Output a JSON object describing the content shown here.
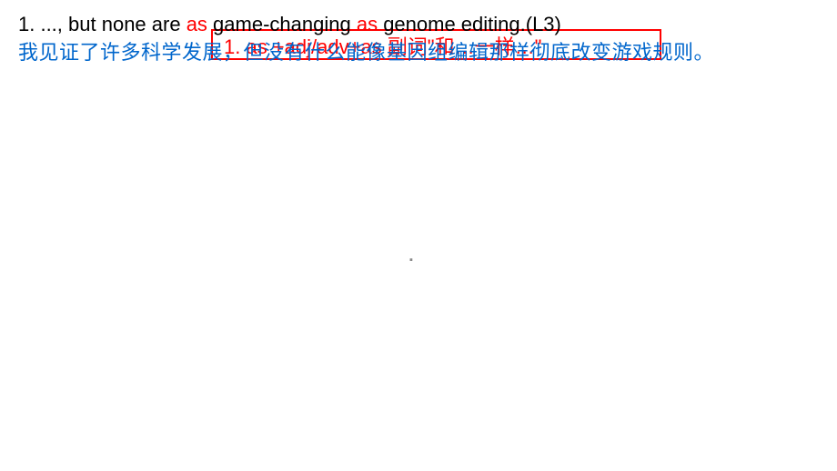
{
  "line1": {
    "prefix": "1. ..., but none are ",
    "as1": "as",
    "mid": " game-changing ",
    "as2": "as",
    "suffix": " genome editing.(L3)"
  },
  "red_box_content": "1. as +adj/adv+as    副词\"和…一样…\"",
  "blue_translation": "我见证了许多科学发展，但没有什么能像基因组编辑那样彻底改变游戏规则。",
  "center_mark": "▪"
}
